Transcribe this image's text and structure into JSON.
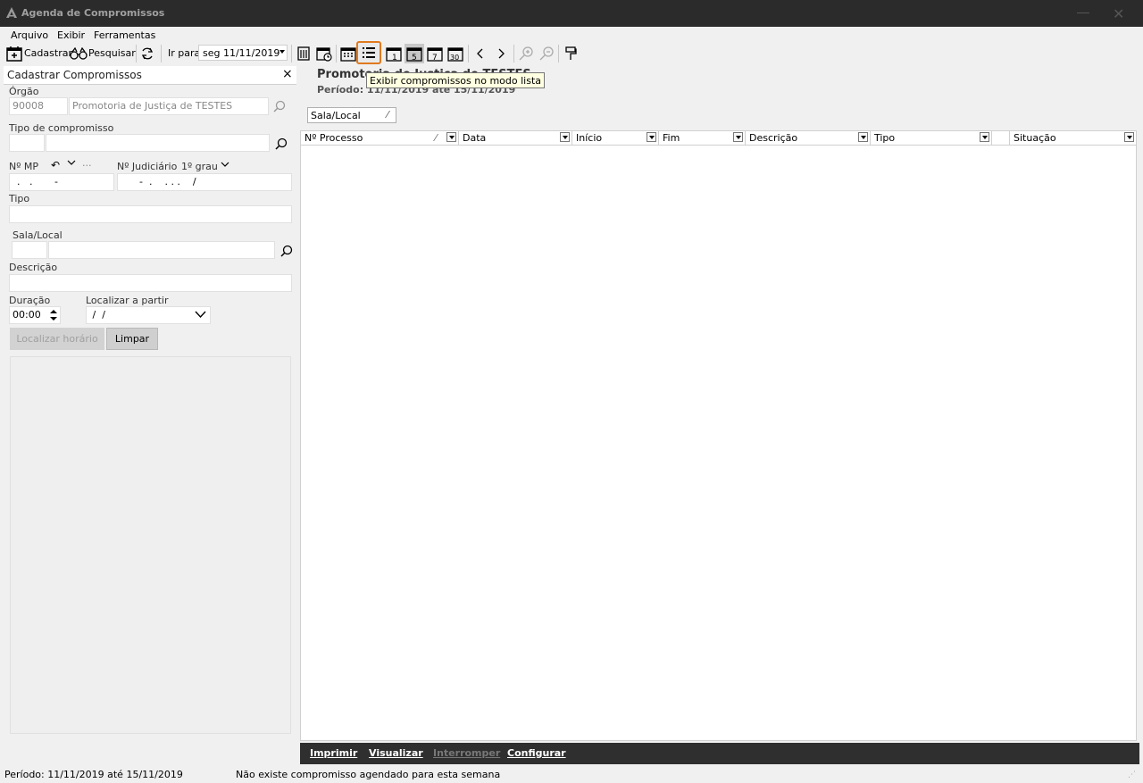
{
  "window": {
    "title": "Agenda de Compromissos"
  },
  "menu": {
    "items": [
      "Arquivo",
      "Exibir",
      "Ferramentas"
    ]
  },
  "toolbar": {
    "cadastrar": "Cadastrar",
    "pesquisar": "Pesquisar",
    "ir_para": "Ir para",
    "date": "seg 11/11/2019",
    "day_numbers": [
      "1",
      "5",
      "7",
      "30"
    ]
  },
  "tooltip": "Exibir compromissos no modo lista",
  "left_panel": {
    "title": "Cadastrar Compromissos",
    "orgao_label": "Órgão",
    "orgao_code": "90008",
    "orgao_name": "Promotoria de Justiça de TESTES",
    "tipo_compromisso_label": "Tipo de compromisso",
    "nmp_label": "Nº MP",
    "nmp_mask": ".   .       -",
    "njud_label": "Nº Judiciário",
    "grau": "1º grau",
    "njud_mask": "-  .    . . .    /",
    "tipo_label": "Tipo",
    "sala_label": "Sala/Local",
    "descricao_label": "Descrição",
    "duracao_label": "Duração",
    "duracao_value": "00:00",
    "localizar_label": "Localizar a partir",
    "localizar_value": " /  /",
    "btn_localizar": "Localizar horário",
    "btn_limpar": "Limpar"
  },
  "main": {
    "heading": "Promotoria de Justiça de TESTES",
    "periodo": "Período: 11/11/2019 até 15/11/2019",
    "group_chip": "Sala/Local",
    "columns": [
      "Nº Processo",
      "Data",
      "Início",
      "Fim",
      "Descrição",
      "Tipo",
      "Situação"
    ]
  },
  "bottom_bar": {
    "imprimir": "Imprimir",
    "visualizar": "Visualizar",
    "interromper": "Interromper",
    "configurar": "Configurar"
  },
  "status": {
    "periodo": "Período: 11/11/2019 até 15/11/2019",
    "message": "Não existe compromisso agendado para esta semana"
  },
  "colors": {
    "accent": "#e07a1f",
    "titlebar": "#2b2b2b",
    "bottombar": "#2f2f2f",
    "tooltip_bg": "#ffffe1"
  }
}
